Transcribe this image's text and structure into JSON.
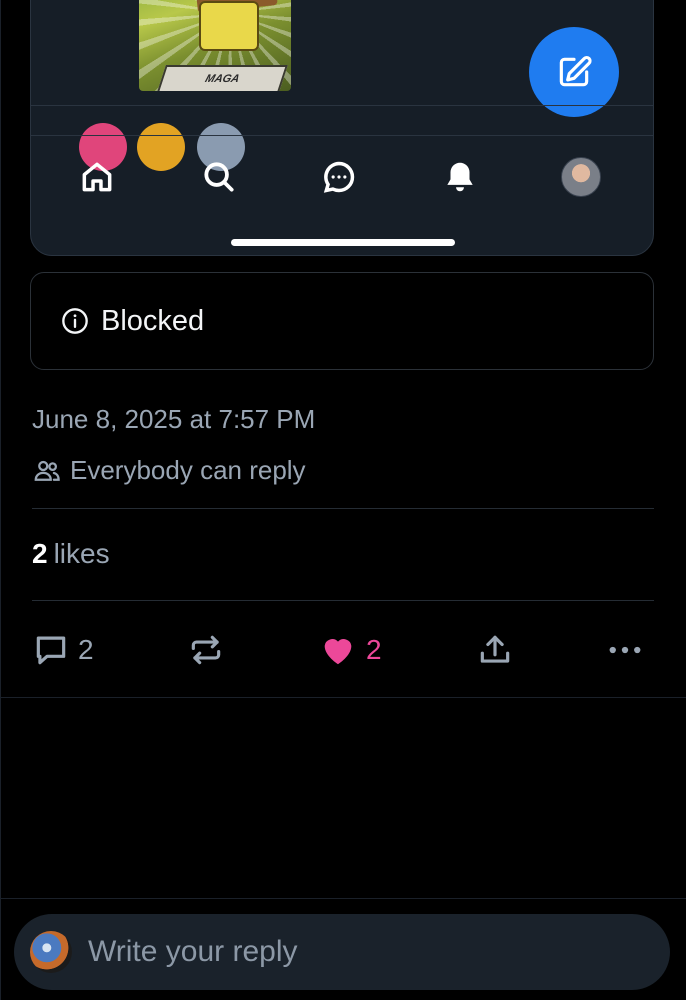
{
  "embed": {
    "meme_caption": "MAGA"
  },
  "notice": {
    "text": "Blocked"
  },
  "post": {
    "date": "June 8, 2025 at 7:57 PM",
    "reply_setting": "Everybody can reply",
    "likes_count": "2",
    "likes_label": "likes"
  },
  "actions": {
    "reply_count": "2",
    "like_count": "2"
  },
  "reply_bar": {
    "placeholder": "Write your reply"
  },
  "colors": {
    "background": "#000000",
    "accent": "#1f7cf0",
    "like": "#ec4899",
    "muted_text": "#9aa6b4"
  },
  "icons": [
    "home-icon",
    "search-icon",
    "chat-icon",
    "bell-icon",
    "compose-icon",
    "info-icon",
    "people-icon",
    "comment-icon",
    "repost-icon",
    "heart-icon",
    "share-icon",
    "more-icon"
  ]
}
